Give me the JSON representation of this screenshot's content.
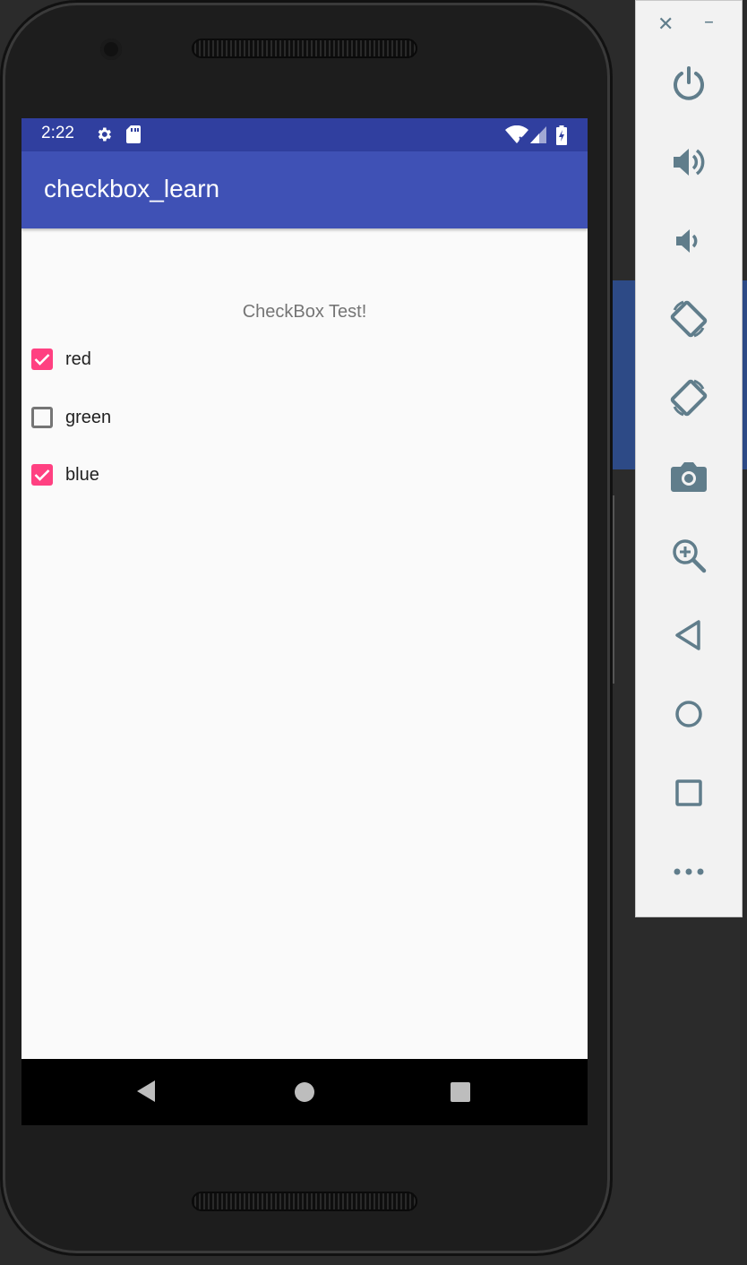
{
  "status_bar": {
    "time": "2:22",
    "icons": [
      "settings-icon",
      "sd-card-icon",
      "wifi-icon",
      "signal-icon",
      "battery-icon"
    ]
  },
  "app_bar": {
    "title": "checkbox_learn"
  },
  "content": {
    "header": "CheckBox Test!",
    "checkboxes": [
      {
        "label": "red",
        "checked": true
      },
      {
        "label": "green",
        "checked": false
      },
      {
        "label": "blue",
        "checked": true
      }
    ]
  },
  "nav_bar": {
    "buttons": [
      "back-icon",
      "home-icon",
      "recents-icon"
    ]
  },
  "emulator_panel": {
    "close": "✕",
    "minimize": "–",
    "buttons": [
      "power-icon",
      "volume-up-icon",
      "volume-down-icon",
      "rotate-left-icon",
      "rotate-right-icon",
      "camera-icon",
      "zoom-icon",
      "back-icon",
      "home-icon",
      "overview-icon",
      "more-icon"
    ]
  },
  "colors": {
    "status_bar": "#303f9f",
    "app_bar": "#3f51b5",
    "accent": "#ff4081",
    "panel_icon": "#607d8b"
  }
}
